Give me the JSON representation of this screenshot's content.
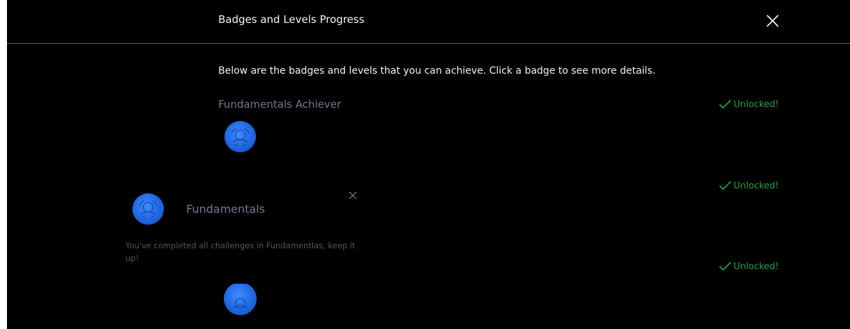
{
  "modal": {
    "title": "Badges and Levels Progress",
    "intro": "Below are the badges and levels that you can achieve. Click a badge to see more details."
  },
  "badges": [
    {
      "name": "Fundamentals Achiever",
      "status": "Unlocked!"
    },
    {
      "name": "",
      "status": "Unlocked!"
    },
    {
      "name": "",
      "status": "Unlocked!"
    }
  ],
  "popover": {
    "title": "Fundamentals",
    "description": "You've completed all challenges in Fundamentlas, keep it up!"
  },
  "colors": {
    "status_green": "#24a148",
    "badge_blue": "#1f66e0",
    "muted_text": "#6f7d90"
  },
  "icons": {
    "close": "close-icon",
    "check": "checkmark-icon",
    "badge": "badge-emblem-icon"
  }
}
